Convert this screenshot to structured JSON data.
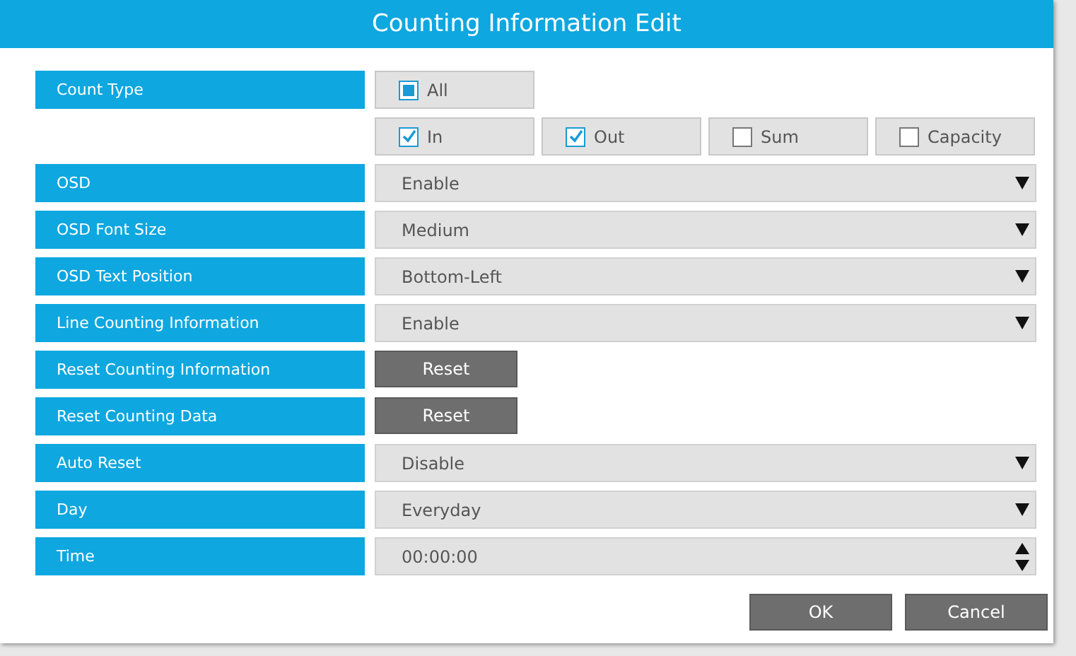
{
  "dialog": {
    "title": "Counting Information Edit"
  },
  "rows": [
    {
      "kind": "checkboxes",
      "label": "Count Type",
      "groups": [
        [
          {
            "label": "All",
            "checked": true,
            "kind": "square"
          }
        ],
        [
          {
            "label": "In",
            "checked": true,
            "kind": "tick"
          },
          {
            "label": "Out",
            "checked": true,
            "kind": "tick"
          },
          {
            "label": "Sum",
            "checked": false,
            "kind": "tick"
          },
          {
            "label": "Capacity",
            "checked": false,
            "kind": "tick"
          }
        ]
      ]
    },
    {
      "kind": "select",
      "label": "OSD",
      "value": "Enable"
    },
    {
      "kind": "select",
      "label": "OSD Font Size",
      "value": "Medium"
    },
    {
      "kind": "select",
      "label": "OSD Text Position",
      "value": "Bottom-Left"
    },
    {
      "kind": "select",
      "label": "Line Counting Information",
      "value": "Enable"
    },
    {
      "kind": "button",
      "label": "Reset Counting Information",
      "value": "Reset"
    },
    {
      "kind": "button",
      "label": "Reset Counting Data",
      "value": "Reset"
    },
    {
      "kind": "select",
      "label": "Auto Reset",
      "value": "Disable"
    },
    {
      "kind": "select",
      "label": "Day",
      "value": "Everyday"
    },
    {
      "kind": "spinner",
      "label": "Time",
      "value": "00:00:00"
    }
  ],
  "buttons": [
    "OK",
    "Cancel"
  ]
}
